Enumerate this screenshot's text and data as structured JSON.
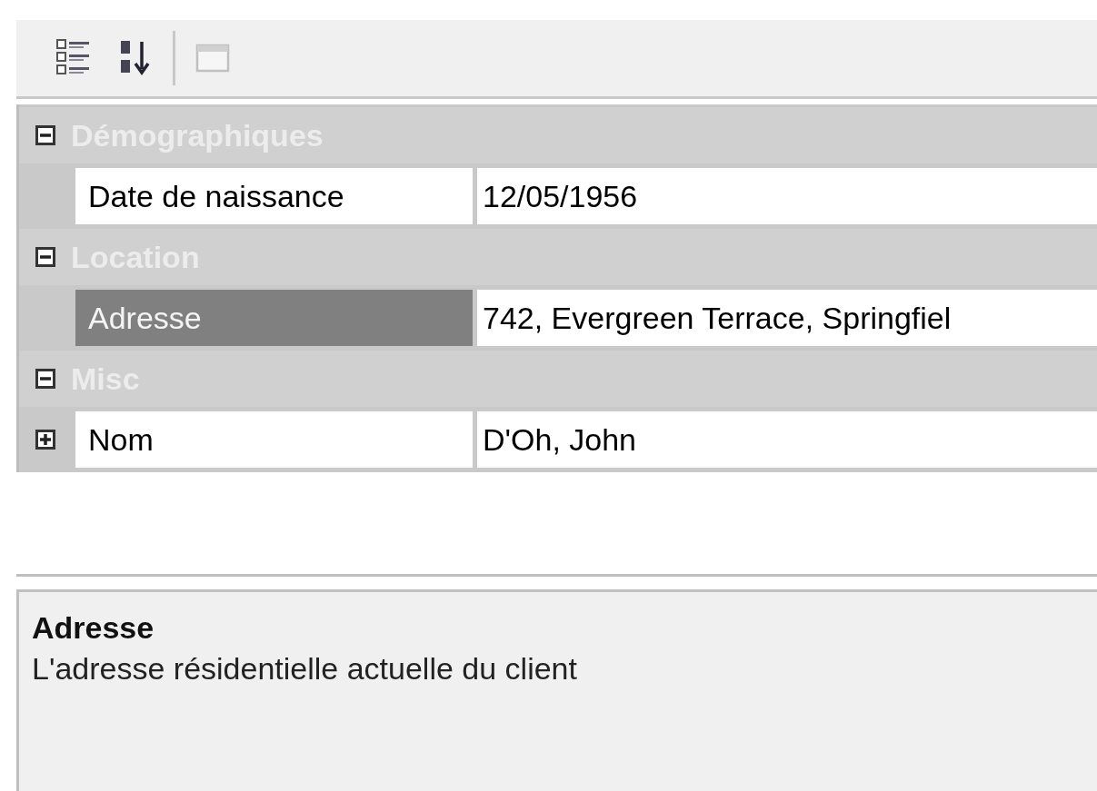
{
  "toolbar": {
    "buttons": [
      {
        "kind": "categorized",
        "disabled": false
      },
      {
        "kind": "alphabetical",
        "disabled": false
      },
      {
        "kind": "separator"
      },
      {
        "kind": "pages",
        "disabled": true
      }
    ]
  },
  "categories": [
    {
      "name": "Démographiques",
      "expanded": true,
      "properties": [
        {
          "label": "Date de naissance",
          "value": "12/05/1956",
          "selected": false
        }
      ]
    },
    {
      "name": "Location",
      "expanded": true,
      "properties": [
        {
          "label": "Adresse",
          "value": "742, Evergreen Terrace, Springfiel",
          "selected": true
        }
      ]
    },
    {
      "name": "Misc",
      "expanded": true,
      "properties": [
        {
          "label": "Nom",
          "value": "D'Oh, John",
          "selected": false,
          "expanded": false
        }
      ]
    }
  ],
  "description": {
    "title": "Adresse",
    "text": "L'adresse résidentielle actuelle du client"
  }
}
